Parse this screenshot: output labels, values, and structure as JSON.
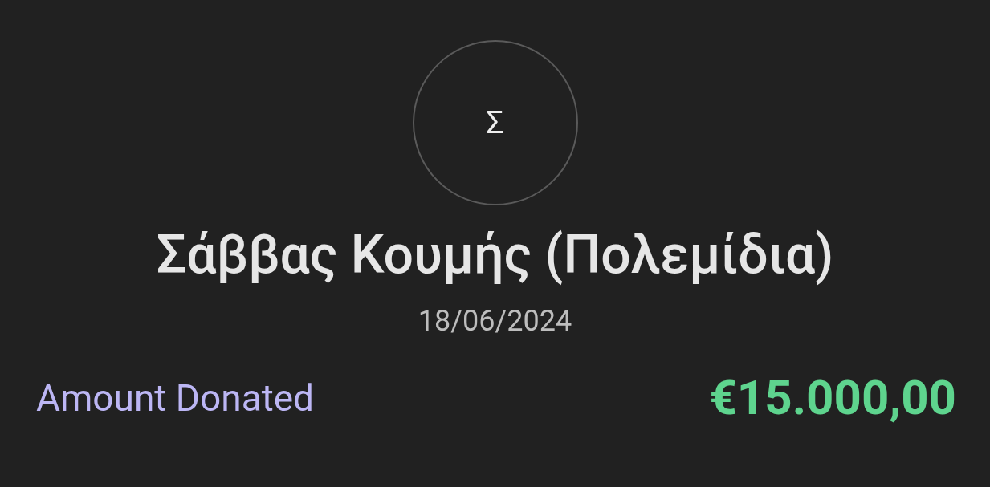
{
  "avatar": {
    "initial": "Σ"
  },
  "donor": {
    "name": "Σάββας Κουμής (Πολεμίδια)",
    "date": "18/06/2024"
  },
  "amount": {
    "label": "Amount Donated",
    "value": "€15.000,00"
  }
}
